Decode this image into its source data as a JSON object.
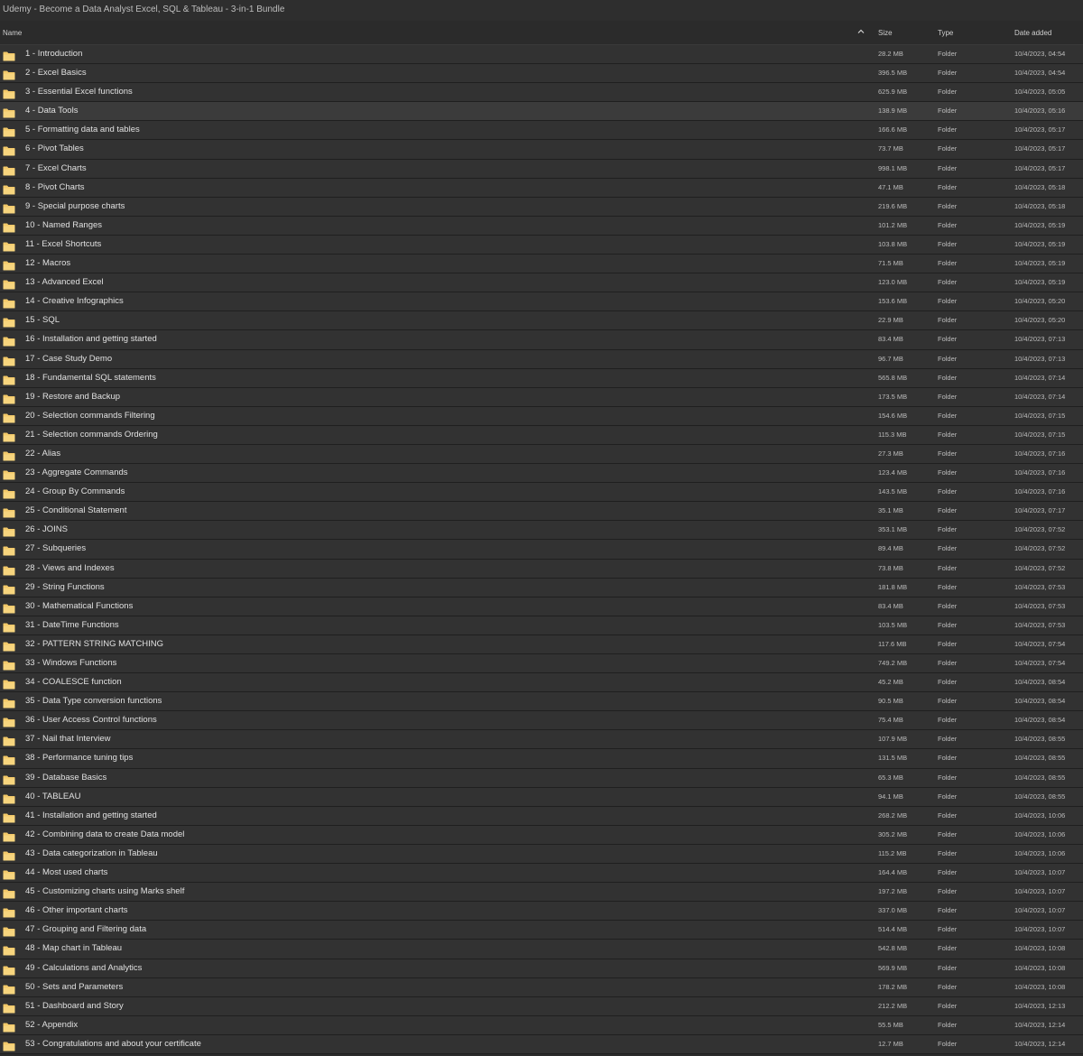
{
  "window": {
    "title": "Udemy - Become a Data Analyst Excel, SQL & Tableau - 3-in-1 Bundle"
  },
  "columns": {
    "name": "Name",
    "size": "Size",
    "type": "Type",
    "date": "Date added"
  },
  "colors": {
    "background": "#2b2b2b",
    "row": "#323232",
    "selected_row": "#3b3b3b",
    "folder": "#f3c969"
  },
  "icons": {
    "folder": "folder-icon",
    "sort": "chevron-up-icon"
  },
  "files": [
    {
      "name": "1 - Introduction",
      "size": "28.2 MB",
      "type": "Folder",
      "date": "10/4/2023, 04:54"
    },
    {
      "name": "2 - Excel Basics",
      "size": "396.5 MB",
      "type": "Folder",
      "date": "10/4/2023, 04:54"
    },
    {
      "name": "3 - Essential Excel functions",
      "size": "625.9 MB",
      "type": "Folder",
      "date": "10/4/2023, 05:05"
    },
    {
      "name": "4 - Data Tools",
      "size": "138.9 MB",
      "type": "Folder",
      "date": "10/4/2023, 05:16",
      "selected": true
    },
    {
      "name": "5 - Formatting data and tables",
      "size": "166.6 MB",
      "type": "Folder",
      "date": "10/4/2023, 05:17"
    },
    {
      "name": "6 - Pivot Tables",
      "size": "73.7 MB",
      "type": "Folder",
      "date": "10/4/2023, 05:17"
    },
    {
      "name": "7 - Excel Charts",
      "size": "998.1 MB",
      "type": "Folder",
      "date": "10/4/2023, 05:17"
    },
    {
      "name": "8 - Pivot Charts",
      "size": "47.1 MB",
      "type": "Folder",
      "date": "10/4/2023, 05:18"
    },
    {
      "name": "9 - Special purpose charts",
      "size": "219.6 MB",
      "type": "Folder",
      "date": "10/4/2023, 05:18"
    },
    {
      "name": "10 - Named Ranges",
      "size": "101.2 MB",
      "type": "Folder",
      "date": "10/4/2023, 05:19"
    },
    {
      "name": "11 - Excel Shortcuts",
      "size": "103.8 MB",
      "type": "Folder",
      "date": "10/4/2023, 05:19"
    },
    {
      "name": "12 - Macros",
      "size": "71.5 MB",
      "type": "Folder",
      "date": "10/4/2023, 05:19"
    },
    {
      "name": "13 - Advanced Excel",
      "size": "123.0 MB",
      "type": "Folder",
      "date": "10/4/2023, 05:19"
    },
    {
      "name": "14 - Creative Infographics",
      "size": "153.6 MB",
      "type": "Folder",
      "date": "10/4/2023, 05:20"
    },
    {
      "name": "15 - SQL",
      "size": "22.9 MB",
      "type": "Folder",
      "date": "10/4/2023, 05:20"
    },
    {
      "name": "16 - Installation and getting started",
      "size": "83.4 MB",
      "type": "Folder",
      "date": "10/4/2023, 07:13"
    },
    {
      "name": "17 - Case Study Demo",
      "size": "96.7 MB",
      "type": "Folder",
      "date": "10/4/2023, 07:13"
    },
    {
      "name": "18 - Fundamental SQL statements",
      "size": "565.8 MB",
      "type": "Folder",
      "date": "10/4/2023, 07:14"
    },
    {
      "name": "19 - Restore and Backup",
      "size": "173.5 MB",
      "type": "Folder",
      "date": "10/4/2023, 07:14"
    },
    {
      "name": "20 - Selection commands Filtering",
      "size": "154.6 MB",
      "type": "Folder",
      "date": "10/4/2023, 07:15"
    },
    {
      "name": "21 - Selection commands Ordering",
      "size": "115.3 MB",
      "type": "Folder",
      "date": "10/4/2023, 07:15"
    },
    {
      "name": "22 - Alias",
      "size": "27.3 MB",
      "type": "Folder",
      "date": "10/4/2023, 07:16"
    },
    {
      "name": "23 - Aggregate Commands",
      "size": "123.4 MB",
      "type": "Folder",
      "date": "10/4/2023, 07:16"
    },
    {
      "name": "24 - Group By Commands",
      "size": "143.5 MB",
      "type": "Folder",
      "date": "10/4/2023, 07:16"
    },
    {
      "name": "25 - Conditional Statement",
      "size": "35.1 MB",
      "type": "Folder",
      "date": "10/4/2023, 07:17"
    },
    {
      "name": "26 - JOINS",
      "size": "353.1 MB",
      "type": "Folder",
      "date": "10/4/2023, 07:52"
    },
    {
      "name": "27 - Subqueries",
      "size": "89.4 MB",
      "type": "Folder",
      "date": "10/4/2023, 07:52"
    },
    {
      "name": "28 - Views and Indexes",
      "size": "73.8 MB",
      "type": "Folder",
      "date": "10/4/2023, 07:52"
    },
    {
      "name": "29 - String Functions",
      "size": "181.8 MB",
      "type": "Folder",
      "date": "10/4/2023, 07:53"
    },
    {
      "name": "30 - Mathematical Functions",
      "size": "83.4 MB",
      "type": "Folder",
      "date": "10/4/2023, 07:53"
    },
    {
      "name": "31 - DateTime Functions",
      "size": "103.5 MB",
      "type": "Folder",
      "date": "10/4/2023, 07:53"
    },
    {
      "name": "32 - PATTERN STRING MATCHING",
      "size": "117.6 MB",
      "type": "Folder",
      "date": "10/4/2023, 07:54"
    },
    {
      "name": "33 - Windows Functions",
      "size": "749.2 MB",
      "type": "Folder",
      "date": "10/4/2023, 07:54"
    },
    {
      "name": "34 - COALESCE function",
      "size": "45.2 MB",
      "type": "Folder",
      "date": "10/4/2023, 08:54"
    },
    {
      "name": "35 - Data Type conversion functions",
      "size": "90.5 MB",
      "type": "Folder",
      "date": "10/4/2023, 08:54"
    },
    {
      "name": "36 - User Access Control functions",
      "size": "75.4 MB",
      "type": "Folder",
      "date": "10/4/2023, 08:54"
    },
    {
      "name": "37 - Nail that Interview",
      "size": "107.9 MB",
      "type": "Folder",
      "date": "10/4/2023, 08:55"
    },
    {
      "name": "38 - Performance tuning tips",
      "size": "131.5 MB",
      "type": "Folder",
      "date": "10/4/2023, 08:55"
    },
    {
      "name": "39 - Database Basics",
      "size": "65.3 MB",
      "type": "Folder",
      "date": "10/4/2023, 08:55"
    },
    {
      "name": "40 - TABLEAU",
      "size": "94.1 MB",
      "type": "Folder",
      "date": "10/4/2023, 08:55"
    },
    {
      "name": "41 - Installation and getting started",
      "size": "268.2 MB",
      "type": "Folder",
      "date": "10/4/2023, 10:06"
    },
    {
      "name": "42 - Combining data to create Data model",
      "size": "305.2 MB",
      "type": "Folder",
      "date": "10/4/2023, 10:06"
    },
    {
      "name": "43 - Data categorization in Tableau",
      "size": "115.2 MB",
      "type": "Folder",
      "date": "10/4/2023, 10:06"
    },
    {
      "name": "44 - Most used charts",
      "size": "164.4 MB",
      "type": "Folder",
      "date": "10/4/2023, 10:07"
    },
    {
      "name": "45 - Customizing charts using Marks shelf",
      "size": "197.2 MB",
      "type": "Folder",
      "date": "10/4/2023, 10:07"
    },
    {
      "name": "46 - Other important charts",
      "size": "337.0 MB",
      "type": "Folder",
      "date": "10/4/2023, 10:07"
    },
    {
      "name": "47 - Grouping and Filtering data",
      "size": "514.4 MB",
      "type": "Folder",
      "date": "10/4/2023, 10:07"
    },
    {
      "name": "48 - Map chart in Tableau",
      "size": "542.8 MB",
      "type": "Folder",
      "date": "10/4/2023, 10:08"
    },
    {
      "name": "49 - Calculations and Analytics",
      "size": "569.9 MB",
      "type": "Folder",
      "date": "10/4/2023, 10:08"
    },
    {
      "name": "50 - Sets and Parameters",
      "size": "178.2 MB",
      "type": "Folder",
      "date": "10/4/2023, 10:08"
    },
    {
      "name": "51 - Dashboard and Story",
      "size": "212.2 MB",
      "type": "Folder",
      "date": "10/4/2023, 12:13"
    },
    {
      "name": "52 - Appendix",
      "size": "55.5 MB",
      "type": "Folder",
      "date": "10/4/2023, 12:14"
    },
    {
      "name": "53 - Congratulations and about your certificate",
      "size": "12.7 MB",
      "type": "Folder",
      "date": "10/4/2023, 12:14"
    }
  ]
}
